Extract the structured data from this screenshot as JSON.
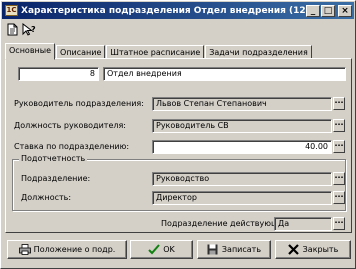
{
  "window": {
    "title": "Характеристика подразделения Отдел внедрения (12...",
    "app_icon_text": "1С",
    "controls": {
      "minimize": "_",
      "maximize": "□",
      "close": "×"
    }
  },
  "toolbar": {
    "items": [
      "page-icon",
      "help-cursor-icon"
    ]
  },
  "tabs": [
    {
      "label": "Основные",
      "active": true
    },
    {
      "label": "Описание",
      "active": false
    },
    {
      "label": "Штатное расписание",
      "active": false
    },
    {
      "label": "Задачи подразделения",
      "active": false
    }
  ],
  "main": {
    "code_value": "8",
    "name_value": "Отдел внедрения",
    "head_label": "Руководитель подразделения:",
    "head_value": "Львов Степан Степанович",
    "head_position_label": "Должность руководителя:",
    "head_position_value": "Руководитель СВ",
    "rate_label": "Ставка по подразделению:",
    "rate_value": "40.00",
    "subordination": {
      "title": "Подотчетность",
      "dept_label": "Подразделение:",
      "dept_value": "Руководство",
      "position_label": "Должность:",
      "position_value": "Директор"
    },
    "active_label": "Подразделение действующее:",
    "active_value": "Да"
  },
  "buttons": {
    "regulation": "Положение о подр.",
    "ok": "OK",
    "save": "Записать",
    "close": "Закрыть"
  },
  "colors": {
    "titlebar": "#0a246a",
    "face": "#d4d0c8",
    "ok_check": "#108010",
    "close_x": "#000000"
  }
}
